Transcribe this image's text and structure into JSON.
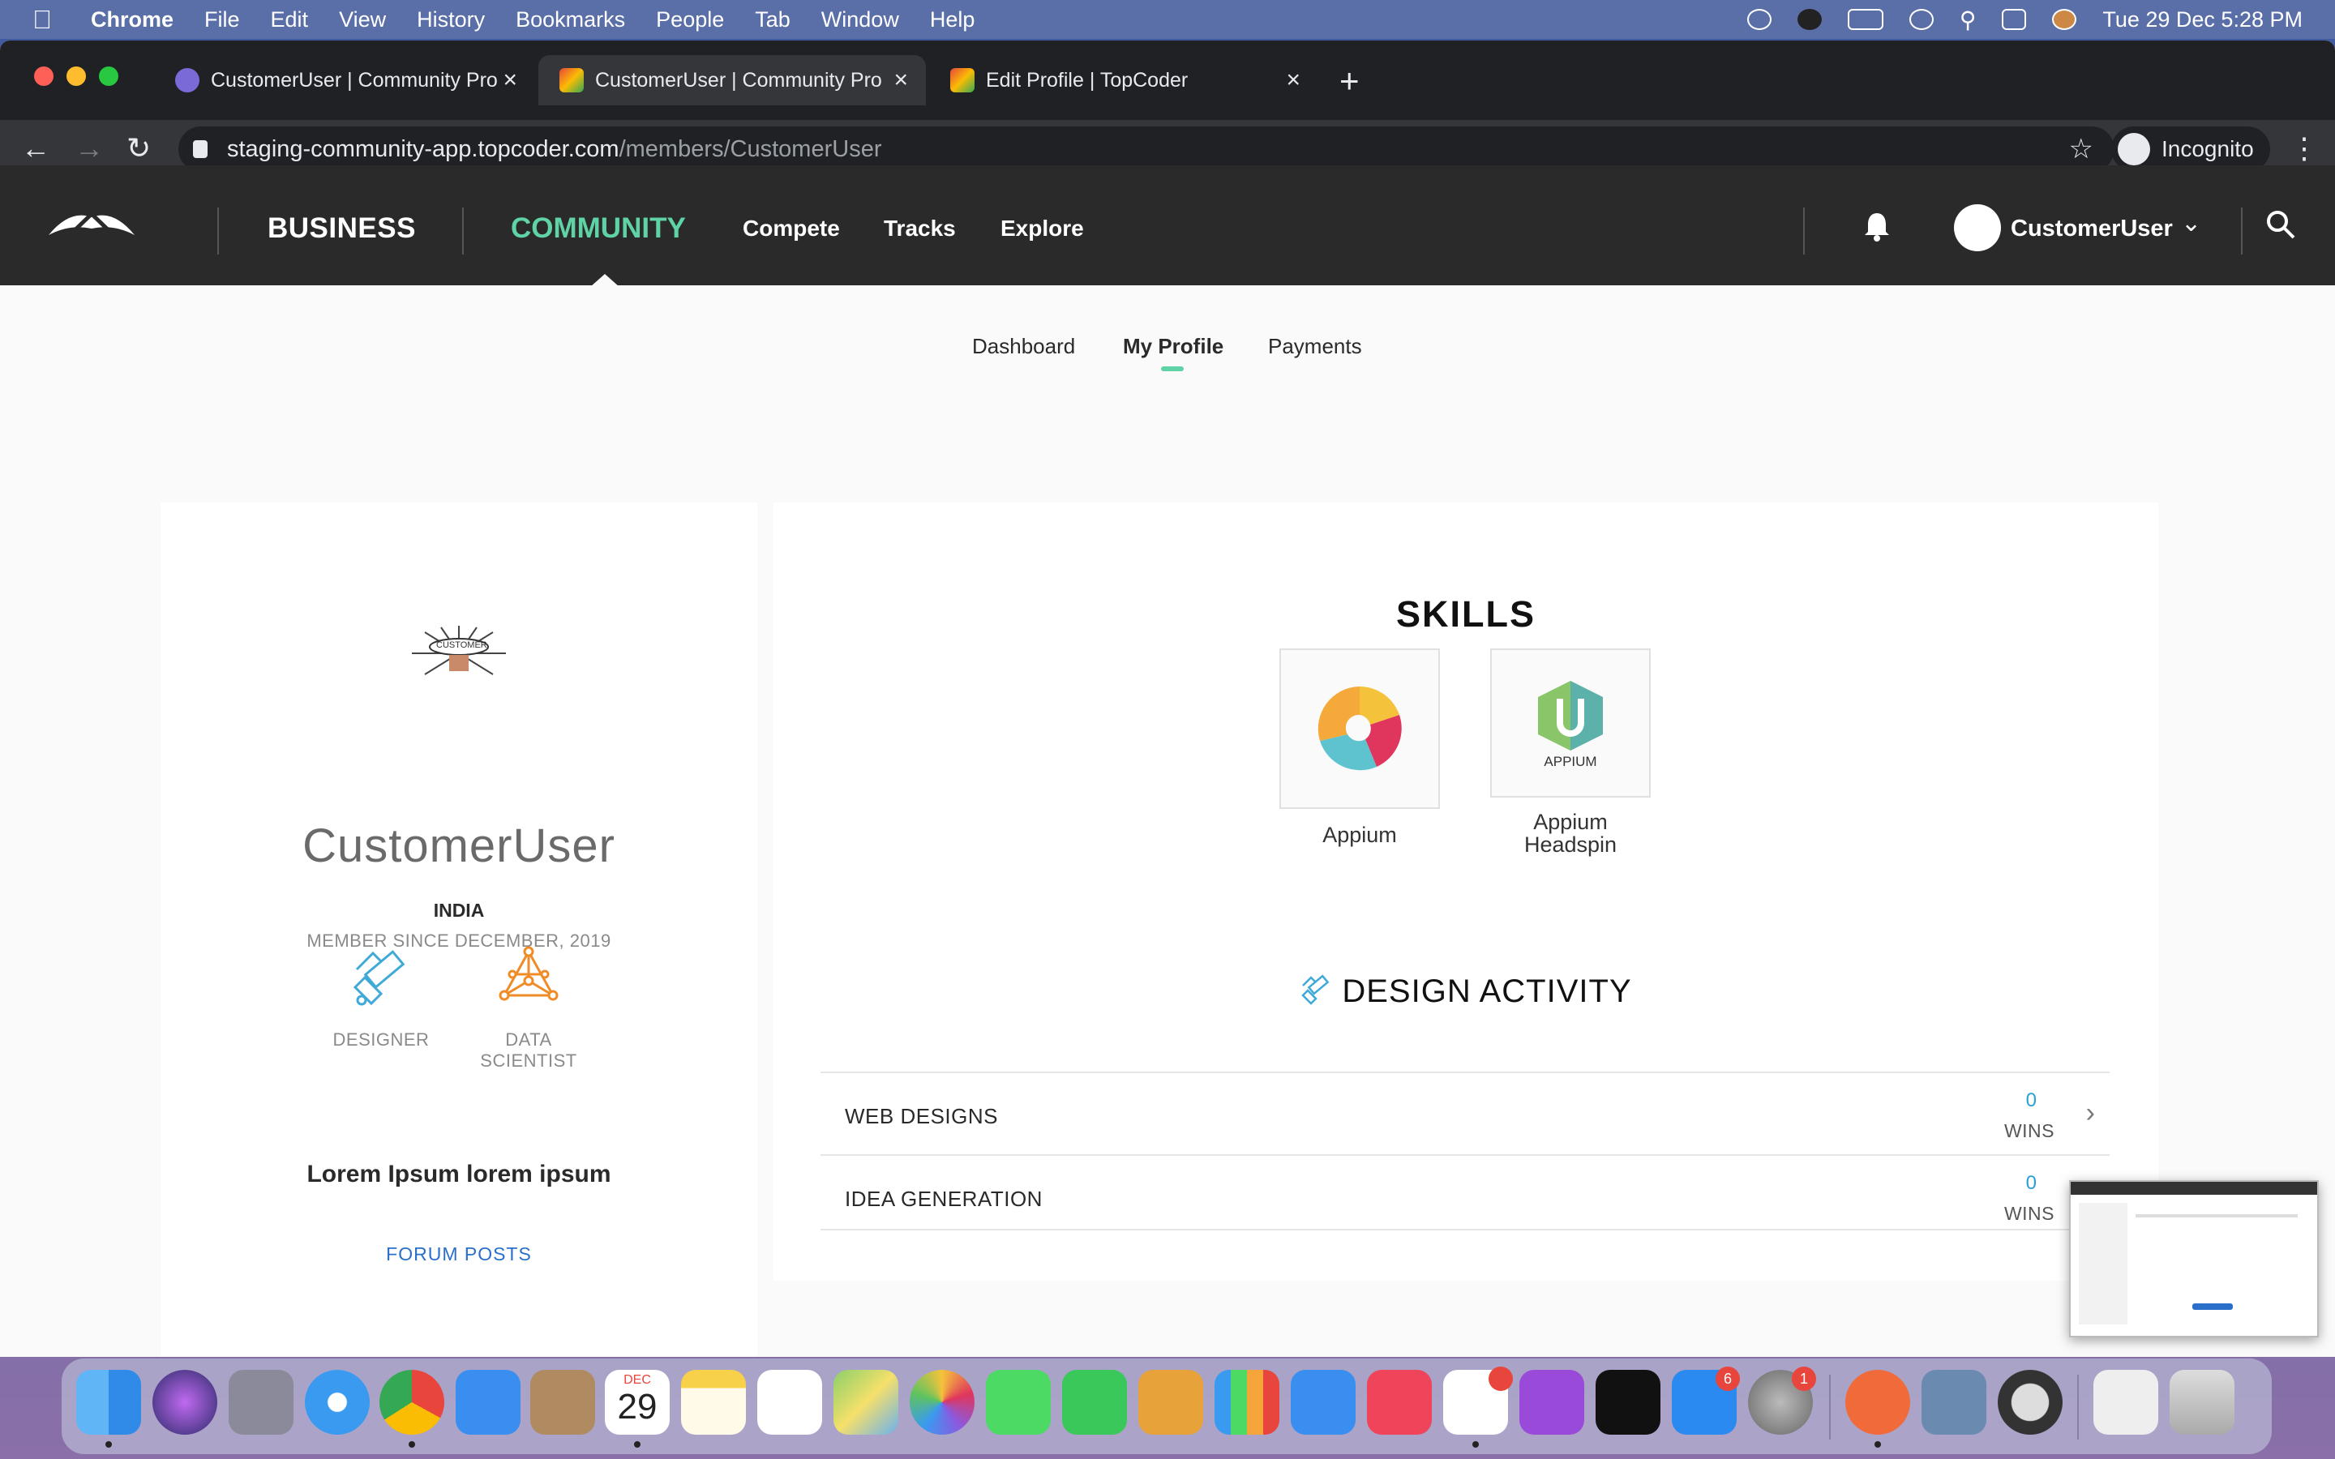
{
  "menubar": {
    "app": "Chrome",
    "items": [
      "File",
      "Edit",
      "View",
      "History",
      "Bookmarks",
      "People",
      "Tab",
      "Window",
      "Help"
    ],
    "clock": "Tue 29 Dec  5:28 PM"
  },
  "browser": {
    "tabs": [
      {
        "title": "CustomerUser | Community Pro"
      },
      {
        "title": "CustomerUser | Community Pro"
      },
      {
        "title": "Edit Profile | TopCoder"
      }
    ],
    "url_host": "staging-community-app.topcoder.com",
    "url_path": "/members/CustomerUser",
    "incognito_label": "Incognito"
  },
  "site": {
    "nav_business": "BUSINESS",
    "nav_community": "COMMUNITY",
    "nav_links": [
      "Compete",
      "Tracks",
      "Explore"
    ],
    "username": "CustomerUser",
    "accent": "#5fd3a5"
  },
  "subnav": {
    "dashboard": "Dashboard",
    "my_profile": "My Profile",
    "payments": "Payments"
  },
  "profile": {
    "avatar_text": "CUSTOMER",
    "name": "CustomerUser",
    "country": "INDIA",
    "member_since": "MEMBER SINCE DECEMBER, 2019",
    "roles": [
      {
        "line1": "DESIGNER",
        "line2": ""
      },
      {
        "line1": "DATA",
        "line2": "SCIENTIST"
      }
    ],
    "description": "Lorem Ipsum lorem ipsum",
    "forum_posts": "FORUM POSTS"
  },
  "skills": {
    "title": "SKILLS",
    "items": [
      {
        "line1": "Appium",
        "line2": ""
      },
      {
        "line1": "Appium",
        "line2": "Headspin",
        "icon_text": "APPIUM"
      }
    ]
  },
  "design_activity": {
    "title": "DESIGN ACTIVITY",
    "rows": [
      {
        "label": "WEB DESIGNS",
        "count": "0",
        "unit": "WINS"
      },
      {
        "label": "IDEA GENERATION",
        "count": "0",
        "unit": "WINS"
      }
    ]
  },
  "dock": {
    "calendar_month": "DEC",
    "calendar_day": "29",
    "badges": [
      "6",
      "1"
    ]
  }
}
